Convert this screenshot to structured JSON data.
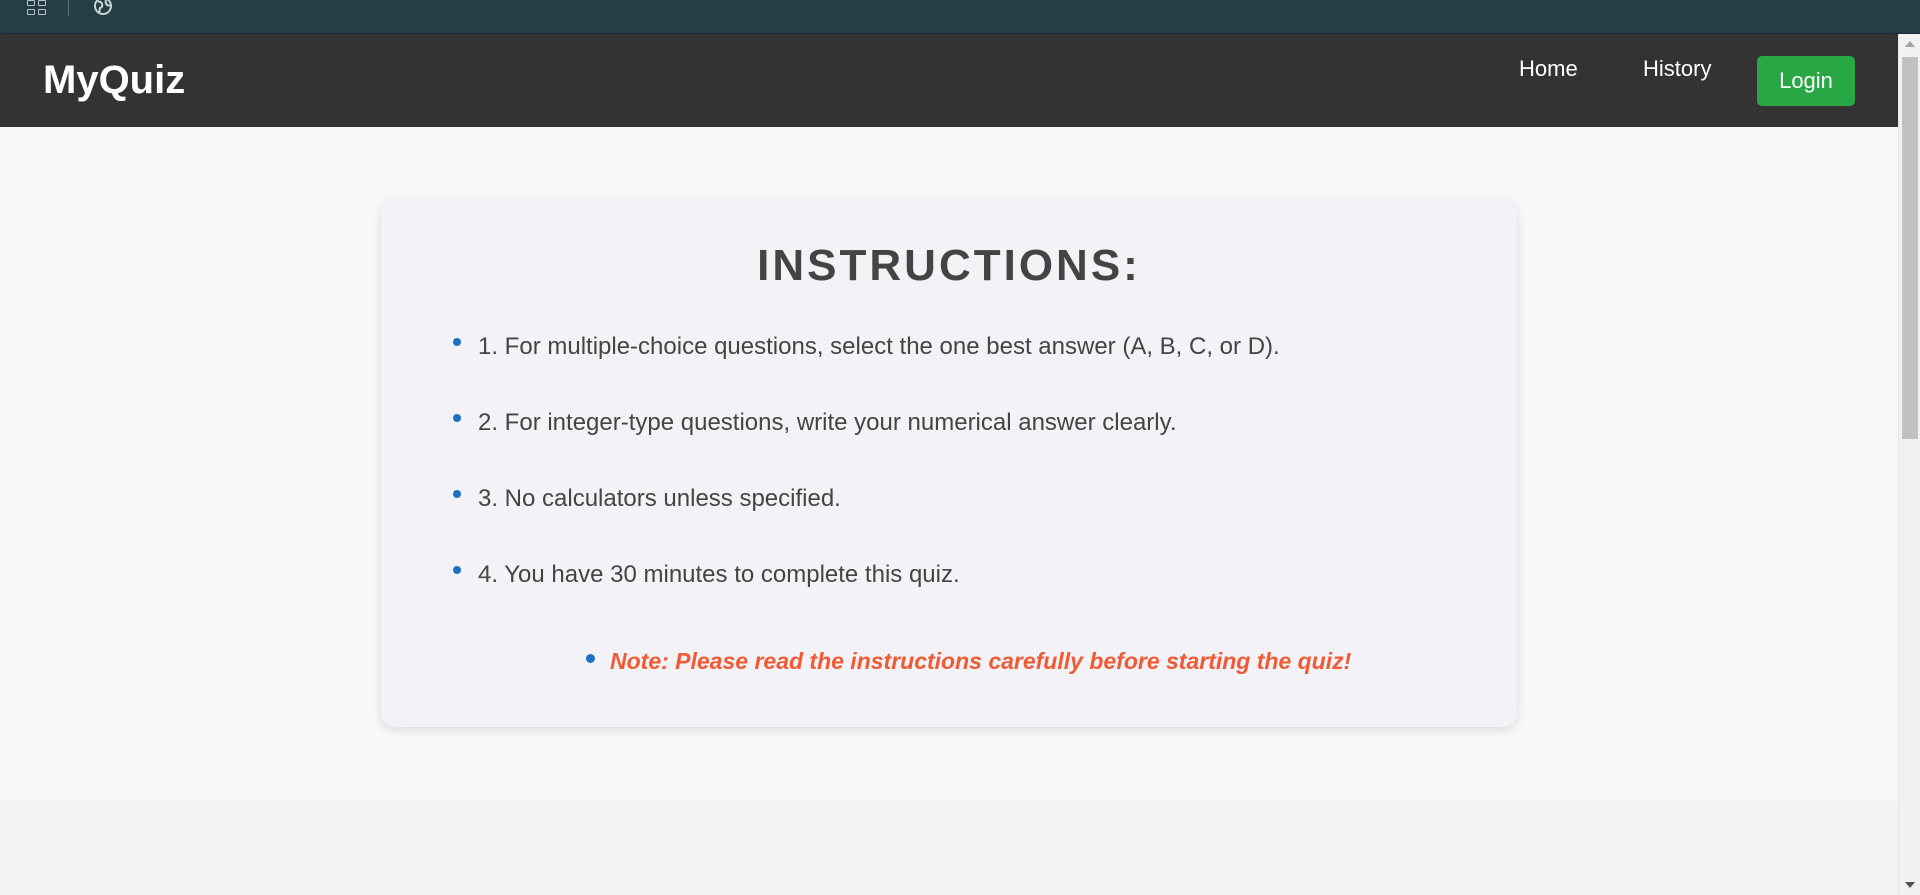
{
  "browser_strip": {
    "icons": [
      "apps-grid-icon",
      "globe-icon"
    ]
  },
  "navbar": {
    "brand": "MyQuiz",
    "links": [
      "Home",
      "History"
    ],
    "login_label": "Login",
    "login_color": "#28a745",
    "background": "#333333"
  },
  "card": {
    "title": "INSTRUCTIONS:",
    "items": [
      "1. For multiple-choice questions, select the one best answer (A, B, C, or D).",
      "2. For integer-type questions, write your numerical answer clearly.",
      "3. No calculators unless specified.",
      "4. You have 30 minutes to complete this quiz."
    ],
    "note": "Note: Please read the instructions carefully before starting the quiz!",
    "note_color": "#f05a35",
    "bullet_color": "#1f6fc6"
  }
}
